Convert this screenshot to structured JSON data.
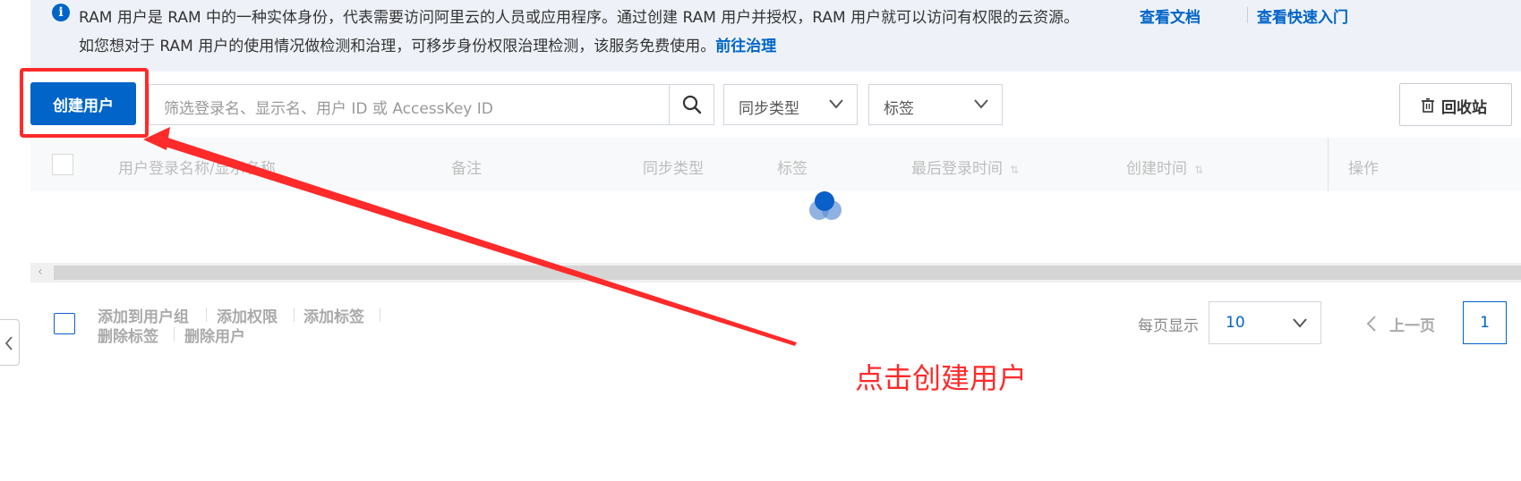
{
  "notice": {
    "line1": "RAM 用户是 RAM 中的一种实体身份，代表需要访问阿里云的人员或应用程序。通过创建 RAM 用户并授权，RAM 用户就可以访问有权限的云资源。",
    "doc_link": "查看文档",
    "quick_link": "查看快速入门",
    "line2": "如您想对于 RAM 用户的使用情况做检测和治理，可移步身份权限治理检测，该服务免费使用。",
    "governance_link": "前往治理"
  },
  "toolbar": {
    "create_label": "创建用户",
    "search_placeholder": "筛选登录名、显示名、用户 ID 或 AccessKey ID",
    "sync_type": "同步类型",
    "tags": "标签",
    "recycle": "回收站"
  },
  "table": {
    "columns": [
      "用户登录名称/显示名称",
      "备注",
      "同步类型",
      "标签",
      "最后登录时间",
      "创建时间",
      "操作"
    ]
  },
  "batch_actions": [
    "添加到用户组",
    "添加权限",
    "添加标签",
    "删除标签",
    "删除用户"
  ],
  "pagination": {
    "per_page_label": "每页显示",
    "per_page_value": "10",
    "prev_label": "上一页",
    "current_page": "1"
  },
  "annotation": {
    "text": "点击创建用户",
    "color": "#ff2a2a"
  },
  "colors": {
    "primary": "#0064c8",
    "notice_bg": "#eef2f8"
  }
}
